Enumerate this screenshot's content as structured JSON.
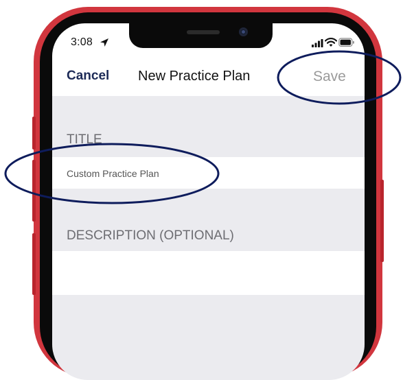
{
  "status_bar": {
    "time": "3:08"
  },
  "nav": {
    "cancel_label": "Cancel",
    "title": "New Practice Plan",
    "save_label": "Save"
  },
  "form": {
    "title_header": "TITLE",
    "title_value": "Custom Practice Plan",
    "description_header": "DESCRIPTION (OPTIONAL)",
    "description_value": ""
  },
  "colors": {
    "phone_frame": "#d1363e",
    "annotation": "#0e1c5c",
    "cancel": "#1d2b57",
    "save_disabled": "#9a9a9a"
  },
  "icons": [
    "location-arrow-icon",
    "signal-icon",
    "wifi-icon",
    "battery-icon"
  ]
}
